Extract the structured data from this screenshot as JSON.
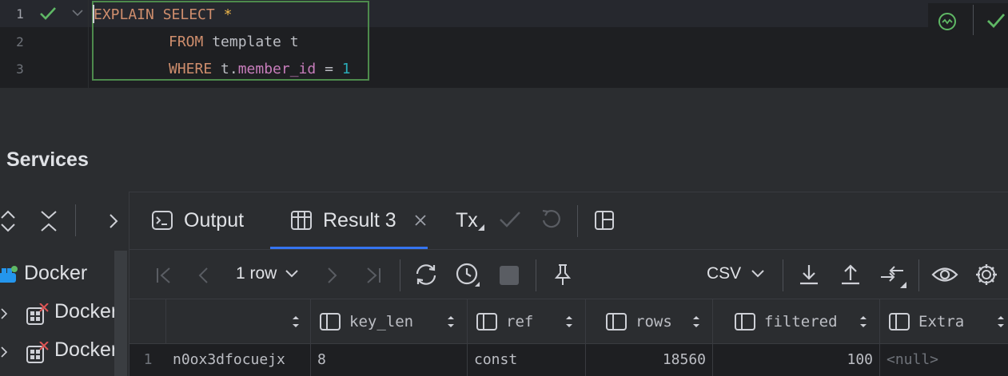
{
  "editor": {
    "line_numbers": [
      "1",
      "2",
      "3"
    ],
    "line1": {
      "kw1": "EXPLAIN",
      "kw2": "SELECT",
      "star": "*"
    },
    "line2": {
      "kw": "FROM",
      "rest": " template t"
    },
    "line3": {
      "kw": "WHERE",
      "alias": " t.",
      "field": "member_id",
      "op": " = ",
      "value": "1"
    }
  },
  "services": {
    "title": "Services",
    "tree": [
      {
        "label": "Docker"
      },
      {
        "label": "Docker-"
      },
      {
        "label": "Docker-"
      }
    ]
  },
  "tabs": {
    "output": "Output",
    "result": "Result 3",
    "tx": "Tx"
  },
  "toolbar": {
    "rows": "1 row",
    "export_format": "CSV"
  },
  "table": {
    "columns": [
      "key_len",
      "ref",
      "rows",
      "filtered",
      "Extra"
    ],
    "row_number": "1",
    "row": {
      "key": "n0ox3dfocuejx",
      "key_len": "8",
      "ref": "const",
      "rows": "18560",
      "filtered": "100",
      "extra": "<null>"
    }
  },
  "colors": {
    "accent": "#3574f0",
    "ok_green": "#5fb865",
    "keyword": "#cf8e6d",
    "field": "#c77dbb",
    "number": "#2aacb8"
  }
}
